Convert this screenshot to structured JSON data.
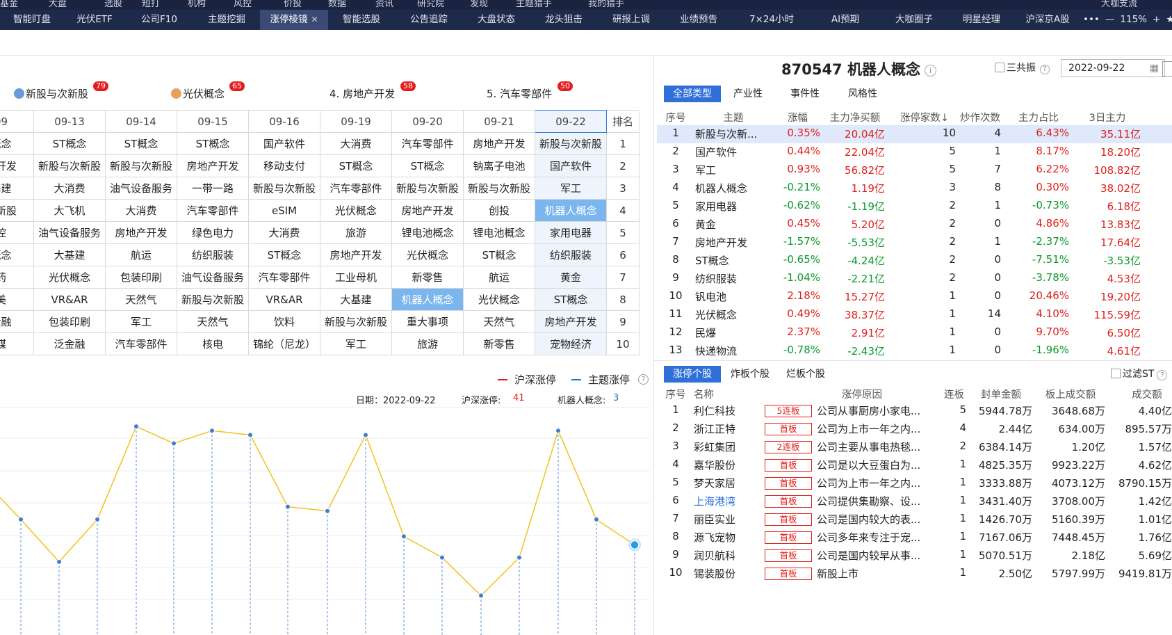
{
  "top_strip": [
    "基金",
    "大盘",
    "选股",
    "短打",
    "机构",
    "风控",
    "价投",
    "数据",
    "资讯",
    "研究院",
    "发现",
    "主题猎手",
    "我的猎手",
    "大咖支流"
  ],
  "tabs": [
    "智能盯盘",
    "光伏ETF",
    "公司F10",
    "主题挖掘",
    "涨停棱镜",
    "智能选股",
    "公告追踪",
    "大盘状态",
    "龙头狙击",
    "研报上调",
    "业绩预告",
    "7×24小时",
    "AI预期",
    "大咖圈子",
    "明星经理",
    "沪深京A股"
  ],
  "active_tab": "涨停棱镜",
  "window_controls": {
    "more": "•••",
    "minus": "—",
    "zoom": "115%",
    "plus": "+",
    "star": "★",
    "down": "⌄"
  },
  "hot_themes": [
    {
      "label": "新股与次新股",
      "count": "79",
      "icon_color": "#6a9bd8"
    },
    {
      "label": "光伏概念",
      "count": "65",
      "icon_color": "#e8a15a"
    },
    {
      "label": "4. 房地产开发",
      "count": "58",
      "icon_color": ""
    },
    {
      "label": "5. 汽车零部件",
      "count": "50",
      "icon_color": ""
    }
  ],
  "grid": {
    "dates": [
      "09",
      "09-13",
      "09-14",
      "09-15",
      "09-16",
      "09-19",
      "09-20",
      "09-21",
      "09-22"
    ],
    "rank_header": "排名",
    "rows": [
      [
        "概念",
        "ST概念",
        "ST概念",
        "ST概念",
        "国产软件",
        "大消费",
        "汽车零部件",
        "房地产开发",
        "新股与次新股"
      ],
      [
        "产开发",
        "新股与次新股",
        "新股与次新股",
        "房地产开发",
        "移动支付",
        "ST概念",
        "ST概念",
        "钠离子电池",
        "国产软件"
      ],
      [
        "基建",
        "大消费",
        "油气设备服务",
        "一带一路",
        "新股与次新股",
        "汽车零部件",
        "新股与次新股",
        "新股与次新股",
        "军工"
      ],
      [
        "次新股",
        "大飞机",
        "大消费",
        "汽车零部件",
        "eSIM",
        "光伏概念",
        "房地产开发",
        "创投",
        "机器人概念"
      ],
      [
        "控",
        "油气设备服务",
        "房地产开发",
        "绿色电力",
        "大消费",
        "旅游",
        "锂电池概念",
        "锂电池概念",
        "家用电器"
      ],
      [
        "概念",
        "大基建",
        "航运",
        "纺织服装",
        "ST概念",
        "房地产开发",
        "光伏概念",
        "ST概念",
        "纺织服装"
      ],
      [
        "药",
        "光伏概念",
        "包装印刷",
        "油气设备服务",
        "汽车零部件",
        "工业母机",
        "新零售",
        "航运",
        "黄金"
      ],
      [
        "美",
        "VR&AR",
        "天然气",
        "新股与次新股",
        "VR&AR",
        "大基建",
        "机器人概念",
        "光伏概念",
        "ST概念"
      ],
      [
        "金融",
        "包装印刷",
        "军工",
        "天然气",
        "饮料",
        "新股与次新股",
        "重大事项",
        "天然气",
        "房地产开发"
      ],
      [
        "煤",
        "泛金融",
        "汽车零部件",
        "核电",
        "锦纶（尼龙）",
        "军工",
        "旅游",
        "新零售",
        "宠物经济"
      ]
    ],
    "ranks": [
      "1",
      "2",
      "3",
      "4",
      "5",
      "6",
      "7",
      "8",
      "9",
      "10"
    ],
    "highlight": [
      "3-8",
      "7-6"
    ]
  },
  "chart_legend": {
    "a": "沪深涨停",
    "b": "主题涨停",
    "a_color": "#e0201a",
    "b_color": "#2a6fd6"
  },
  "chart_info": {
    "date_label": "日期：2022-09-22",
    "hs_label": "沪深涨停:",
    "hs_value": "41",
    "theme_label": "机器人概念:",
    "theme_value": "3"
  },
  "chart_data": {
    "type": "line",
    "series": [
      {
        "values": [
          76,
          66,
          56,
          66,
          88,
          84,
          87,
          86,
          69,
          68,
          86,
          62,
          57,
          48,
          57,
          87,
          66,
          60
        ]
      }
    ],
    "line_color": "#f2c21b",
    "grid": true
  },
  "right_title": "870547 机器人概念",
  "sanban": "三共振",
  "date_value": "2022-09-22",
  "theme_tabs": [
    "全部类型",
    "产业性",
    "事件性",
    "风格性"
  ],
  "theme_table": {
    "headers": [
      "序号",
      "主题",
      "涨幅",
      "主力净买额",
      "涨停家数↓",
      "炒作次数",
      "主力占比",
      "3日主力"
    ],
    "rows": [
      [
        "1",
        "新股与次新...",
        "0.35%",
        "20.04亿",
        "10",
        "4",
        "6.43%",
        "35.11亿"
      ],
      [
        "2",
        "国产软件",
        "0.44%",
        "22.04亿",
        "5",
        "1",
        "8.17%",
        "18.20亿"
      ],
      [
        "3",
        "军工",
        "0.93%",
        "56.82亿",
        "5",
        "7",
        "6.22%",
        "108.82亿"
      ],
      [
        "4",
        "机器人概念",
        "-0.21%",
        "1.19亿",
        "3",
        "8",
        "0.30%",
        "38.02亿"
      ],
      [
        "5",
        "家用电器",
        "-0.62%",
        "-1.19亿",
        "2",
        "1",
        "-0.73%",
        "6.18亿"
      ],
      [
        "6",
        "黄金",
        "0.45%",
        "5.20亿",
        "2",
        "0",
        "4.86%",
        "13.83亿"
      ],
      [
        "7",
        "房地产开发",
        "-1.57%",
        "-5.53亿",
        "2",
        "1",
        "-2.37%",
        "17.64亿"
      ],
      [
        "8",
        "ST概念",
        "-0.65%",
        "-4.24亿",
        "2",
        "0",
        "-7.51%",
        "-3.53亿"
      ],
      [
        "9",
        "纺织服装",
        "-1.04%",
        "-2.21亿",
        "2",
        "0",
        "-3.78%",
        "4.53亿"
      ],
      [
        "10",
        "钒电池",
        "2.18%",
        "15.27亿",
        "1",
        "0",
        "20.46%",
        "19.20亿"
      ],
      [
        "11",
        "光伏概念",
        "0.49%",
        "38.37亿",
        "1",
        "14",
        "4.10%",
        "115.59亿"
      ],
      [
        "12",
        "民爆",
        "2.37%",
        "2.91亿",
        "1",
        "0",
        "9.70%",
        "6.50亿"
      ],
      [
        "13",
        "快递物流",
        "-0.78%",
        "-2.43亿",
        "1",
        "0",
        "-1.96%",
        "4.61亿"
      ]
    ]
  },
  "stock_tabs": [
    "涨停个股",
    "炸板个股",
    "烂板个股"
  ],
  "filter_st": "过滤ST",
  "stock_table": {
    "headers": [
      "序号",
      "名称",
      "涨停原因",
      "连板",
      "封单金额",
      "板上成交额",
      "成交额"
    ],
    "rows": [
      [
        "1",
        "利仁科技",
        "5连板",
        "公司从事厨房小家电...",
        "5",
        "5944.78万",
        "3648.68万",
        "4.40亿"
      ],
      [
        "2",
        "浙江正特",
        "首板",
        "公司为上市一年之内...",
        "4",
        "2.44亿",
        "634.00万",
        "895.57万"
      ],
      [
        "3",
        "彩虹集团",
        "2连板",
        "公司主要从事电热毯...",
        "2",
        "6384.14万",
        "1.20亿",
        "1.57亿"
      ],
      [
        "4",
        "嘉华股份",
        "首板",
        "公司是以大豆蛋白为...",
        "1",
        "4825.35万",
        "9923.22万",
        "4.62亿"
      ],
      [
        "5",
        "梦天家居",
        "首板",
        "公司为上市一年之内...",
        "1",
        "3333.88万",
        "4073.12万",
        "8790.15万"
      ],
      [
        "6",
        "上海港湾",
        "首板",
        "公司提供集勘察、设...",
        "1",
        "3431.40万",
        "3708.00万",
        "1.42亿"
      ],
      [
        "7",
        "丽臣实业",
        "首板",
        "公司是国内较大的表...",
        "1",
        "1426.70万",
        "5160.39万",
        "1.01亿"
      ],
      [
        "8",
        "源飞宠物",
        "首板",
        "公司多年来专注于宠...",
        "1",
        "7167.06万",
        "7448.45万",
        "1.76亿"
      ],
      [
        "9",
        "润贝航科",
        "首板",
        "公司是国内较早从事...",
        "1",
        "5070.51万",
        "2.18亿",
        "5.69亿"
      ],
      [
        "10",
        "锡装股份",
        "首板",
        "新股上市",
        "1",
        "2.50亿",
        "5797.99万",
        "9419.81万"
      ]
    ]
  }
}
